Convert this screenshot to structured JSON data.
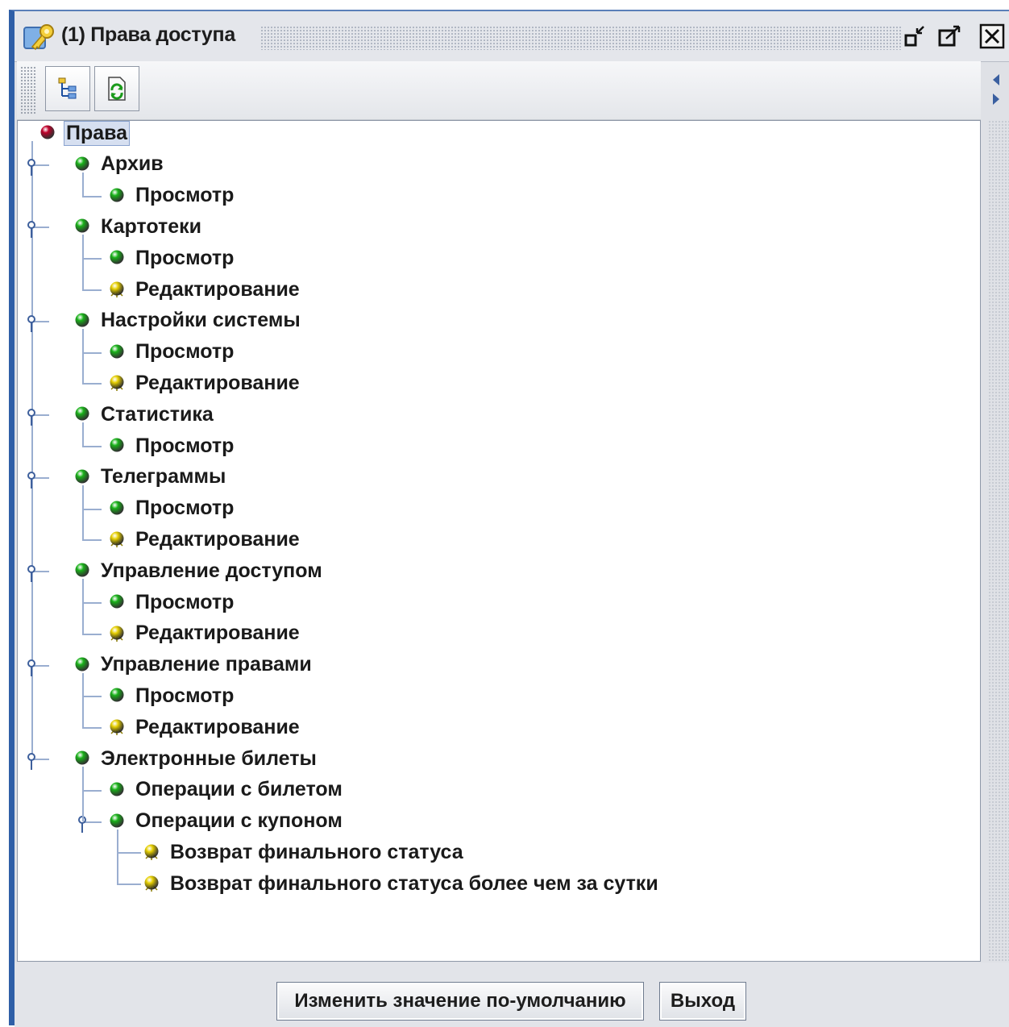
{
  "window": {
    "title": "(1) Права доступа",
    "icon": "keys-icon",
    "controls": [
      "minimize-icon",
      "maximize-icon",
      "close-icon"
    ]
  },
  "toolbar": {
    "tools": [
      {
        "name": "tree-expand-button",
        "icon": "tree-icon"
      },
      {
        "name": "refresh-button",
        "icon": "refresh-icon"
      }
    ]
  },
  "tree": {
    "root": "Права",
    "groups": [
      {
        "label": "Архив",
        "children": [
          "Просмотр"
        ],
        "child_states": [
          "green"
        ]
      },
      {
        "label": "Картотеки",
        "children": [
          "Просмотр",
          "Редактирование"
        ],
        "child_states": [
          "green",
          "yellow"
        ]
      },
      {
        "label": "Настройки системы",
        "children": [
          "Просмотр",
          "Редактирование"
        ],
        "child_states": [
          "green",
          "yellow"
        ]
      },
      {
        "label": "Статистика",
        "children": [
          "Просмотр"
        ],
        "child_states": [
          "green"
        ]
      },
      {
        "label": "Телеграммы",
        "children": [
          "Просмотр",
          "Редактирование"
        ],
        "child_states": [
          "green",
          "yellow"
        ]
      },
      {
        "label": "Управление доступом",
        "children": [
          "Просмотр",
          "Редактирование"
        ],
        "child_states": [
          "green",
          "yellow"
        ]
      },
      {
        "label": "Управление правами",
        "children": [
          "Просмотр",
          "Редактирование"
        ],
        "child_states": [
          "green",
          "yellow"
        ]
      },
      {
        "label": "Электронные билеты",
        "children": [
          "Операции с билетом",
          "Операции с купоном"
        ],
        "child_states": [
          "green",
          "green"
        ]
      }
    ],
    "coupon_children": [
      "Возврат финального статуса",
      "Возврат финального статуса более чем за сутки"
    ],
    "colors": {
      "root": "#c0002a",
      "green": "#19b219",
      "yellow": "#e6cf00",
      "line": "#9aaed0"
    }
  },
  "buttons": {
    "change_default": "Изменить значение по-умолчанию",
    "exit": "Выход"
  }
}
